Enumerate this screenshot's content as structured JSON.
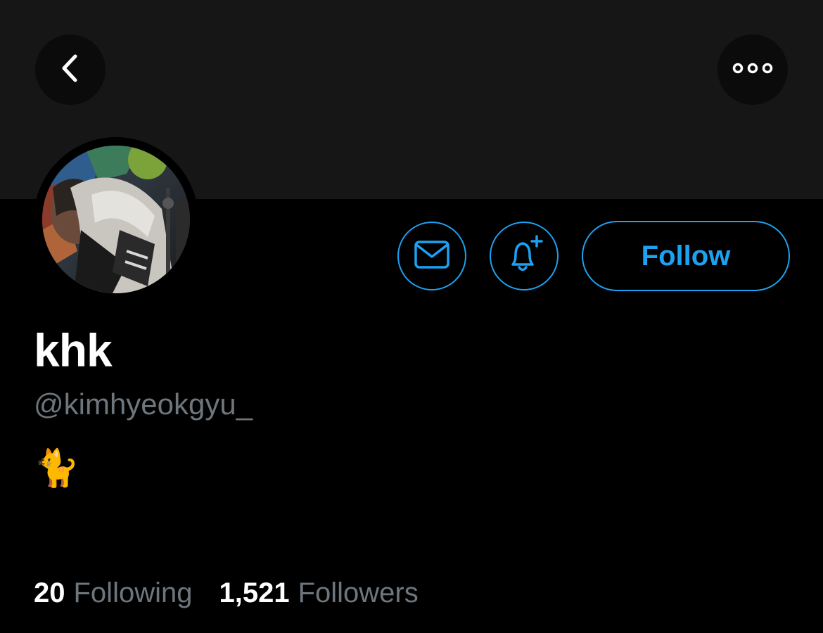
{
  "header": {
    "back_icon": "chevron-left-icon",
    "more_icon": "more-horizontal-icon"
  },
  "profile": {
    "display_name": "khk",
    "handle": "@kimhyeokgyu_",
    "bio": "🐈"
  },
  "actions": {
    "message_icon": "mail-icon",
    "notify_icon": "bell-plus-icon",
    "follow_label": "Follow"
  },
  "stats": {
    "following_count": "20",
    "following_label": "Following",
    "followers_count": "1,521",
    "followers_label": "Followers"
  },
  "colors": {
    "accent": "#1da1f2",
    "background": "#000000",
    "banner": "#161616",
    "secondary_text": "#6e767d"
  }
}
